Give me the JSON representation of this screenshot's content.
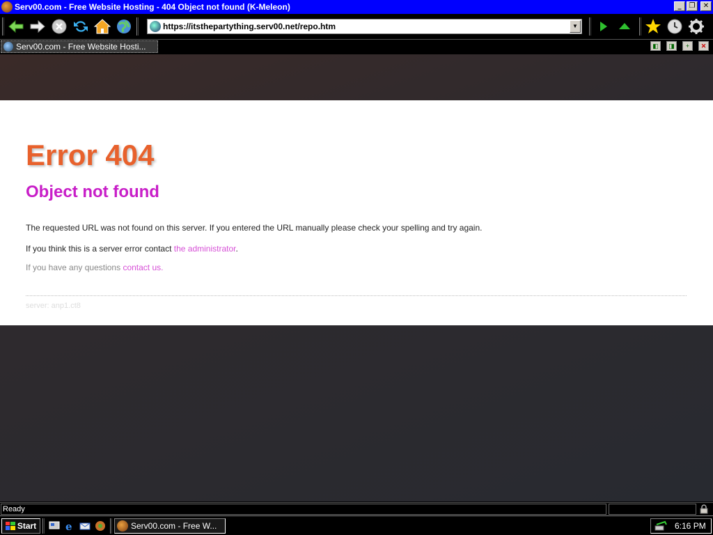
{
  "window": {
    "title": "Serv00.com - Free Website Hosting - 404 Object not found (K-Meleon)"
  },
  "toolbar": {
    "url_value": "https://itsthepartything.serv00.net/repo.htm"
  },
  "tabs": [
    {
      "label": "Serv00.com - Free Website Hosti..."
    }
  ],
  "page": {
    "heading": "Error 404",
    "subheading": "Object not found",
    "message": "The requested URL was not found on this server. If you entered the URL manually please check your spelling and try again.",
    "admin_prefix": "If you think this is a server error contact ",
    "admin_link": "the administrator",
    "admin_suffix": ".",
    "questions_prefix": "If you have any questions ",
    "questions_link": "contact us.",
    "server_signature": "server: anp1.ct8"
  },
  "status": {
    "text": "Ready"
  },
  "taskbar": {
    "start_label": "Start",
    "task_label": "Serv00.com - Free W...",
    "clock": "6:16 PM"
  },
  "colors": {
    "titlebar": "#0000ff",
    "error_heading": "#e8612c",
    "subheading": "#c81ec8",
    "link": "#d64fd6"
  }
}
